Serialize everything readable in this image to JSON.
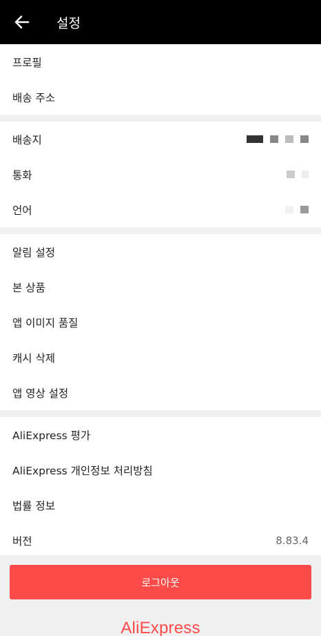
{
  "header": {
    "title": "설정",
    "back_icon": "arrow-left-icon"
  },
  "group1": {
    "profile_label": "프로필",
    "shipping_address_label": "배송 주소"
  },
  "group2": {
    "ship_to_label": "배송지",
    "currency_label": "통화",
    "language_label": "언어"
  },
  "group3": {
    "notifications_label": "알림 설정",
    "viewed_items_label": "본 상품",
    "image_quality_label": "앱 이미지 품질",
    "clear_cache_label": "캐시 삭제",
    "video_settings_label": "앱 영상 설정"
  },
  "group4": {
    "rate_label": "AliExpress 평가",
    "privacy_label": "AliExpress 개인정보 처리방침",
    "legal_label": "법률 정보",
    "version_label": "버전",
    "version_value": "8.83.4"
  },
  "footer": {
    "logout_label": "로그아웃",
    "brand_text": "AliExpress"
  },
  "colors": {
    "accent": "#ff4a4a",
    "header_bg": "#000000",
    "page_bg": "#f0f0f0"
  }
}
